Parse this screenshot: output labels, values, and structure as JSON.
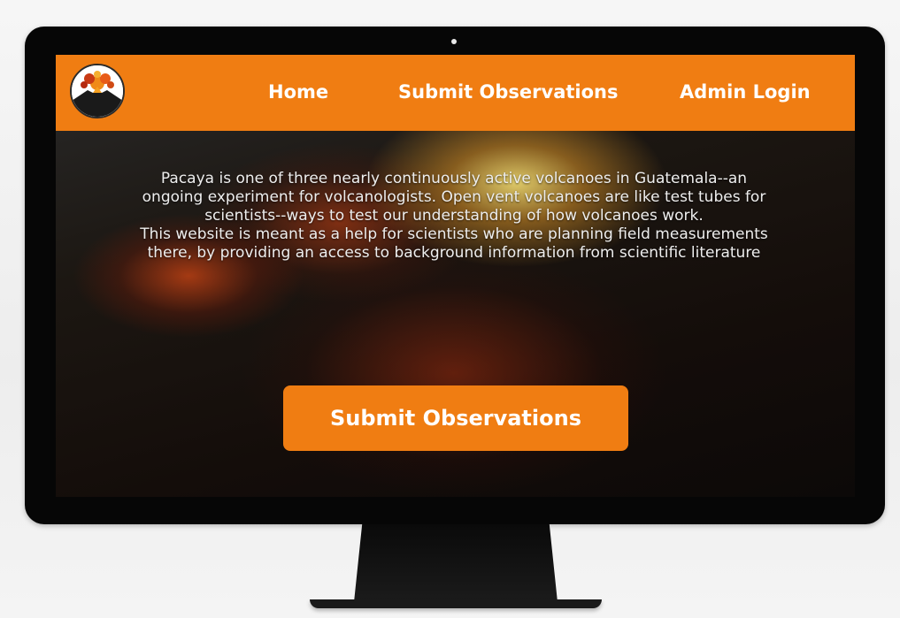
{
  "navbar": {
    "logo_icon": "volcano-eruption-logo-icon",
    "links": {
      "home": "Home",
      "submit": "Submit Observations",
      "admin": "Admin Login"
    }
  },
  "intro": {
    "paragraph_1": "Pacaya is one of three nearly continuously active volcanoes in Guatemala--an ongoing experiment for volcanologists. Open vent volcanoes are like test tubes for scientists--ways to test our understanding of how volcanoes work.",
    "paragraph_2": "This website is meant as a help for scientists who are planning field measurements there, by providing an access to background information from scientific literature"
  },
  "cta": {
    "label": "Submit Observations"
  },
  "colors": {
    "brand_orange": "#f07d12",
    "text_light": "#eeeeee",
    "monitor_bezel": "#060606"
  }
}
